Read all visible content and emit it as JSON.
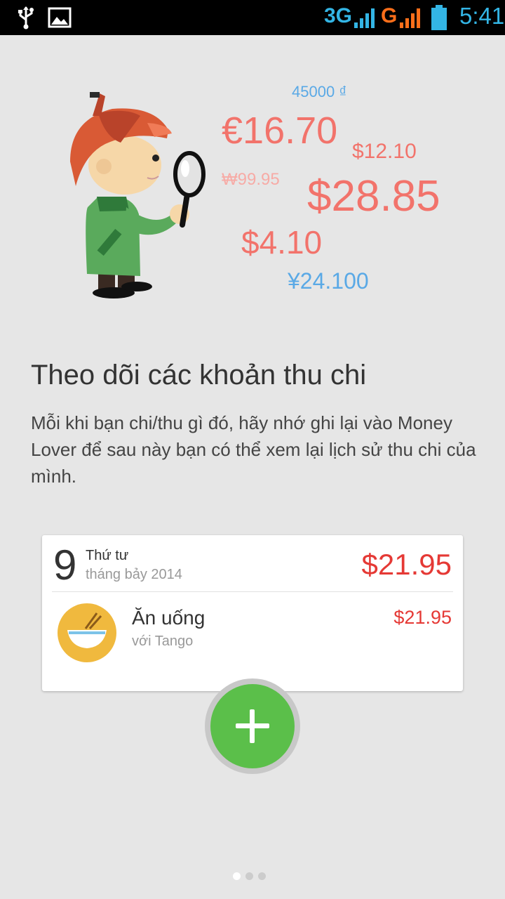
{
  "status_bar": {
    "network_1": "3G",
    "network_2": "G",
    "time": "5:41",
    "icons": [
      "usb-icon",
      "gallery-icon",
      "signal-icon",
      "battery-icon"
    ]
  },
  "illustration": {
    "amounts": [
      "45000 ₫",
      "€16.70",
      "$12.10",
      "₩99.95",
      "$28.85",
      "$4.10",
      "¥24.100"
    ],
    "colors": {
      "red": "#f2736b",
      "blue": "#5aa9e6"
    }
  },
  "intro": {
    "title": "Theo dõi các khoản thu chi",
    "description": "Mỗi khi bạn chi/thu gì đó, hãy nhớ ghi lại vào Money Lover để sau này bạn có thể xem lại lịch sử thu chi của mình."
  },
  "sample_card": {
    "day": "9",
    "weekday": "Thứ tư",
    "month_year": "tháng bảy 2014",
    "total": "$21.95",
    "transaction": {
      "category": "Ăn uống",
      "with": "với Tango",
      "amount": "$21.95",
      "icon": "food-bowl-icon"
    }
  },
  "fab": {
    "icon": "plus-icon",
    "color": "#5bbf4a"
  },
  "pager": {
    "pages": 3,
    "active": 1
  }
}
